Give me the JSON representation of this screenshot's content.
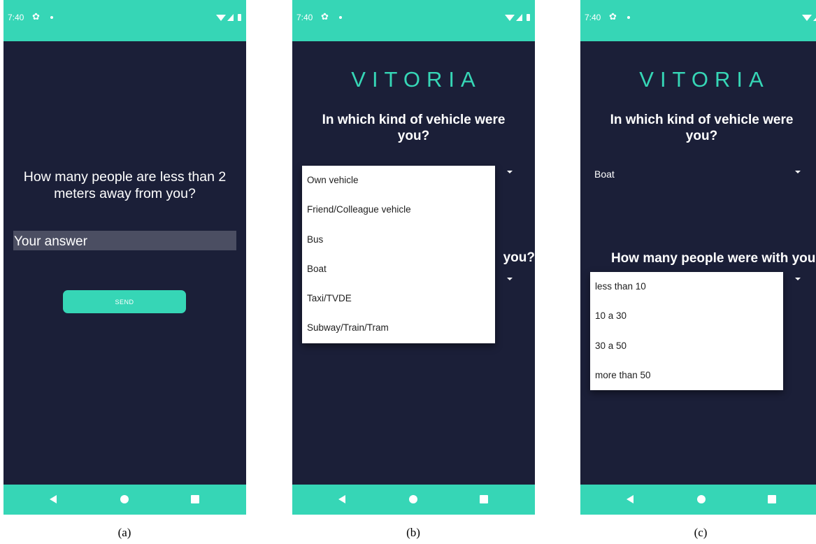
{
  "status_bar": {
    "time": "7:40"
  },
  "screen_a": {
    "question": "How many people are less than 2 meters away from you?",
    "answer_placeholder": "Your answer",
    "send_label": "SEND",
    "caption": "(a)"
  },
  "screen_b": {
    "brand": "VITORIA",
    "question_vehicle": "In which kind of vehicle were you?",
    "question_people_partial": "you?",
    "vehicle_options": [
      "Own vehicle",
      "Friend/Colleague vehicle",
      "Bus",
      "Boat",
      "Taxi/TVDE",
      "Subway/Train/Tram"
    ],
    "caption": "(b)"
  },
  "screen_c": {
    "brand": "VITORIA",
    "question_vehicle": "In which kind of vehicle were you?",
    "vehicle_selected": "Boat",
    "question_people": "How many people were with you?",
    "people_options": [
      "less than 10",
      "10 a 30",
      "30 a 50",
      "more than 50"
    ],
    "caption": "(c)"
  },
  "icons": {
    "settings": "gear-icon",
    "notification": "notification-dot-icon",
    "wifi": "wifi-icon",
    "signal": "signal-icon",
    "battery": "battery-icon",
    "nav_back": "back-triangle-icon",
    "nav_home": "home-circle-icon",
    "nav_recent": "recent-square-icon",
    "dropdown": "dropdown-arrow-icon"
  },
  "colors": {
    "accent": "#36d6b6",
    "background": "#1b1f38",
    "input_background": "#4b4e62",
    "menu_background": "#ffffff"
  }
}
